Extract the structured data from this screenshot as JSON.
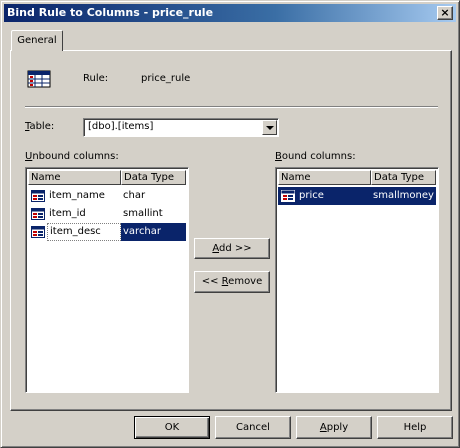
{
  "window": {
    "title": "Bind Rule to Columns - price_rule",
    "close_glyph": "×"
  },
  "tabs": [
    {
      "label": "General"
    }
  ],
  "rule": {
    "label": "Rule:",
    "value": "price_rule",
    "icon": "rule-table-icon"
  },
  "table": {
    "label_accesskey": "T",
    "label_rest": "able:",
    "selected": "[dbo].[items]"
  },
  "unbound": {
    "label_accesskey": "U",
    "label_rest": "nbound columns:",
    "columns": [
      "Name",
      "Data Type"
    ],
    "rows": [
      {
        "name": "item_name",
        "type": "char",
        "selected": false
      },
      {
        "name": "item_id",
        "type": "smallint",
        "selected": false
      },
      {
        "name": "item_desc",
        "type": "varchar",
        "selected": true
      }
    ]
  },
  "bound": {
    "label_accesskey": "B",
    "label_rest": "ound columns:",
    "columns": [
      "Name",
      "Data Type"
    ],
    "rows": [
      {
        "name": "price",
        "type": "smallmoney",
        "selected": true
      }
    ]
  },
  "buttons": {
    "add_accesskey": "A",
    "add_rest": "dd >>",
    "remove_prefix": "<< ",
    "remove_accesskey": "R",
    "remove_rest": "emove",
    "ok": "OK",
    "cancel": "Cancel",
    "apply_accesskey": "A",
    "apply_rest": "pply",
    "help": "Help"
  },
  "colors": {
    "selection": "#0a246a",
    "face": "#d4d0c8",
    "title_start": "#0a246a",
    "title_end": "#a6caf0"
  }
}
